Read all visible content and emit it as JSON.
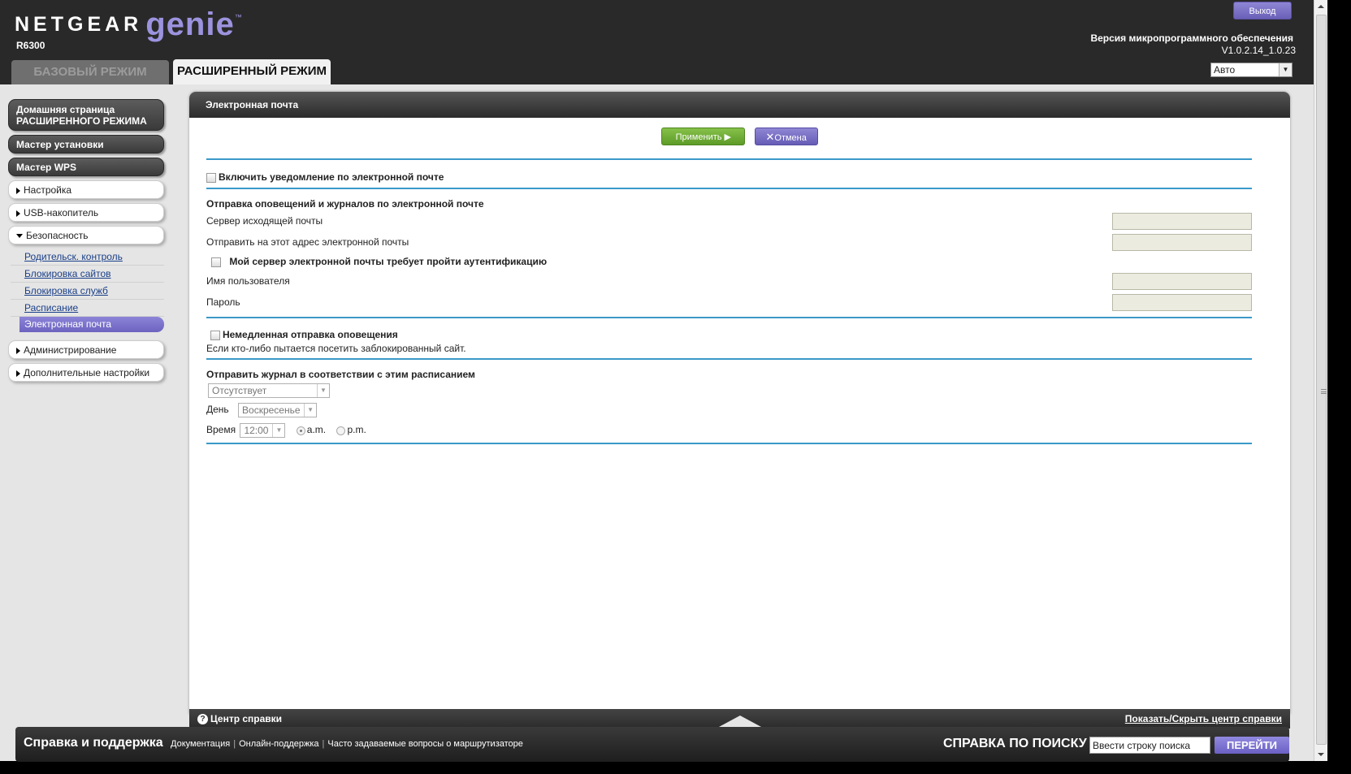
{
  "header": {
    "brand_name": "NETGEAR",
    "brand_product": "genie",
    "brand_tm": "™",
    "model": "R6300",
    "tab_basic": "БАЗОВЫЙ РЕЖИМ",
    "tab_advanced": "РАСШИРЕННЫЙ РЕЖИМ",
    "logout": "Выход",
    "firmware_label": "Версия микропрограммного обеспечения",
    "firmware_version": "V1.0.2.14_1.0.23",
    "language": "Авто"
  },
  "sidebar": {
    "home_line1": "Домашняя страница",
    "home_line2": "РАСШИРЕННОГО РЕЖИМА",
    "setup_wizard": "Мастер установки",
    "wps_wizard": "Мастер WPS",
    "setup": "Настройка",
    "usb": "USB-накопитель",
    "security": "Безопасность",
    "security_items": [
      "Родительск. контроль",
      "Блокировка сайтов",
      "Блокировка служб",
      "Расписание",
      "Электронная почта"
    ],
    "administration": "Администрирование",
    "advanced_settings": "Дополнительные настройки"
  },
  "panel": {
    "title": "Электронная почта",
    "apply": "Применить ▶",
    "cancel": "Отмена",
    "enable_notify": "Включить уведомление по электронной почте",
    "send_section": "Отправка оповещений и журналов по электронной почте",
    "smtp_server": "Сервер исходящей почты",
    "send_to": "Отправить на этот адрес электронной почты",
    "auth_required": "Мой сервер электронной почты требует пройти аутентификацию",
    "username": "Имя пользователя",
    "password": "Пароль",
    "immediate": "Немедленная отправка оповещения",
    "immediate_desc": "Если кто-либо пытается посетить заблокированный сайт.",
    "schedule_title": "Отправить журнал в соответствии с этим расписанием",
    "schedule_value": "Отсутствует",
    "day_label": "День",
    "day_value": "Воскресенье",
    "time_label": "Время",
    "time_value": "12:00",
    "am": "a.m.",
    "pm": "p.m.",
    "help_center": "Центр справки",
    "help_toggle": "Показать/Скрыть центр справки"
  },
  "support": {
    "title": "Справка и поддержка",
    "links": [
      "Документация",
      "Онлайн-поддержка",
      "Часто задаваемые вопросы о маршрутизаторе"
    ],
    "search_title": "СПРАВКА ПО ПОИСКУ",
    "search_placeholder": "Ввести строку поиска",
    "search_button": "ПЕРЕЙТИ"
  }
}
